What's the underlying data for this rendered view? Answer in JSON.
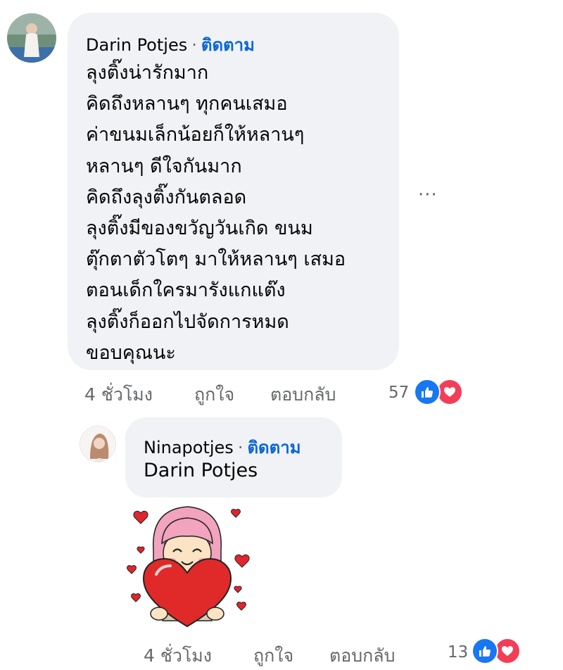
{
  "comment1": {
    "author": "Darin Potjes",
    "follow": "ติดตาม",
    "lines": [
      "ลุงติ๊งน่ารักมาก",
      "คิดถึงหลานๆ ทุกคนเสมอ",
      "ค่าขนมเล็กน้อยก็ให้หลานๆ",
      "หลานๆ ดีใจกันมาก",
      "คิดถึงลุงติ๊งกันตลอด",
      "ลุงติ๊งมีของขวัญวันเกิด ขนม",
      "ตุ๊กตาตัวโตๆ มาให้หลานๆ เสมอ",
      "ตอนเด็กใครมารังแกแต๊ง",
      "ลุงติ๊งก็ออกไปจัดการหมด",
      "ขอบคุณนะ"
    ],
    "time": "4 ชั่วโมง",
    "like": "ถูกใจ",
    "reply": "ตอบกลับ",
    "reaction_count": "57",
    "more": "···"
  },
  "reply1": {
    "author": "Ninapotjes",
    "follow": "ติดตาม",
    "text": "Darin Potjes",
    "time": "4 ชั่วโมง",
    "like": "ถูกใจ",
    "reply": "ตอบกลับ",
    "reaction_count": "13"
  },
  "icons": {
    "like_reaction": "thumbs-up-icon",
    "love_reaction": "heart-icon",
    "sticker": "girl-hugging-heart-sticker"
  },
  "colors": {
    "bubble": "#f0f2f5",
    "follow": "#0a66d6",
    "secondary_text": "#65676b",
    "like_blue": "#1877f2",
    "love_red": "#f33e58"
  }
}
